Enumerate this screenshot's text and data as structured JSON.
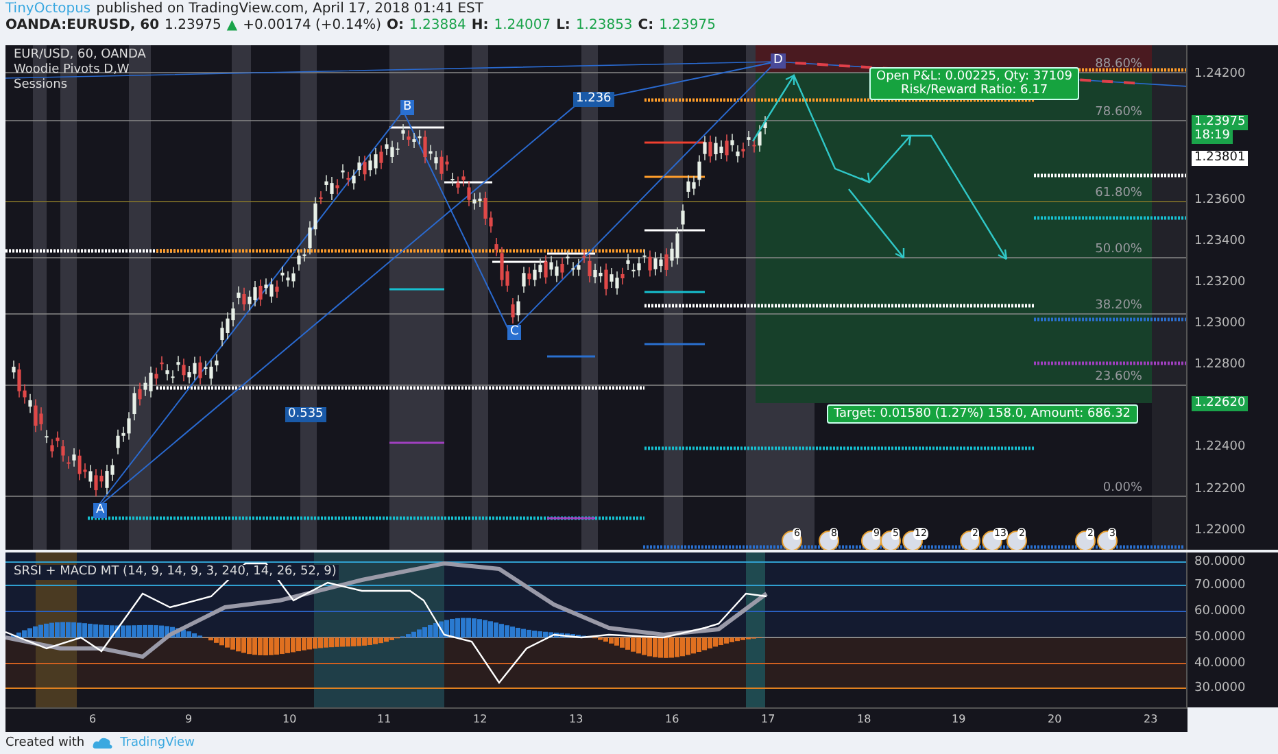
{
  "header": {
    "author": "TinyOctopus",
    "published": "published on TradingView.com, April 17, 2018 01:41 EST",
    "symbol": "OANDA:EURUSD, 60",
    "price": "1.23975",
    "direction": "▲",
    "change": "+0.00174 (+0.14%)",
    "ohlc": [
      {
        "label": "O:",
        "value": "1.23884"
      },
      {
        "label": "H:",
        "value": "1.24007"
      },
      {
        "label": "L:",
        "value": "1.23853"
      },
      {
        "label": "C:",
        "value": "1.23975"
      }
    ]
  },
  "legend": [
    "EUR/USD, 60, OANDA",
    "Woodie Pivots D,W",
    "Sessions"
  ],
  "fib_levels": [
    "88.60%",
    "78.60%",
    "61.80%",
    "50.00%",
    "38.20%",
    "23.60%",
    "0.00%"
  ],
  "pattern_points": [
    {
      "label": "A"
    },
    {
      "label": "B"
    },
    {
      "label": "C"
    },
    {
      "label": "D"
    },
    {
      "label": "1.236"
    },
    {
      "label": "0.535"
    }
  ],
  "position_box": {
    "lines": [
      "Open P&L: 0.00225, Qty: 37109",
      "Risk/Reward Ratio: 6.17"
    ],
    "target": "Target: 0.01580 (1.27%) 158.0, Amount: 686.32"
  },
  "event_flags": [
    {
      "count": "6"
    },
    {
      "count": "8"
    },
    {
      "count": "9"
    },
    {
      "count": "5"
    },
    {
      "count": "12"
    },
    {
      "count": "2"
    },
    {
      "count": "13"
    },
    {
      "count": "2"
    },
    {
      "count": "2"
    },
    {
      "count": "3"
    }
  ],
  "price_axis": [
    {
      "text": "1.24200",
      "kind": "tick"
    },
    {
      "text": "1.23975",
      "kind": "last"
    },
    {
      "text": "18:19",
      "kind": "last"
    },
    {
      "text": "1.23801",
      "kind": "marker"
    },
    {
      "text": "1.23600",
      "kind": "tick"
    },
    {
      "text": "1.23400",
      "kind": "tick"
    },
    {
      "text": "1.23200",
      "kind": "tick"
    },
    {
      "text": "1.23000",
      "kind": "tick"
    },
    {
      "text": "1.22800",
      "kind": "tick"
    },
    {
      "text": "1.22620",
      "kind": "last"
    },
    {
      "text": "1.22400",
      "kind": "tick"
    },
    {
      "text": "1.22200",
      "kind": "tick"
    },
    {
      "text": "1.22000",
      "kind": "tick"
    }
  ],
  "indicator": {
    "title": "SRSI + MACD MT (14, 9, 14, 9, 3, 240, 14, 26, 52, 9)",
    "axis": [
      "80.0000",
      "70.0000",
      "60.0000",
      "50.0000",
      "40.0000",
      "30.0000"
    ]
  },
  "time_axis": [
    "6",
    "9",
    "10",
    "11",
    "12",
    "13",
    "16",
    "17",
    "18",
    "19",
    "20",
    "23"
  ],
  "footer": {
    "created": "Created with",
    "brand": "TradingView"
  }
}
